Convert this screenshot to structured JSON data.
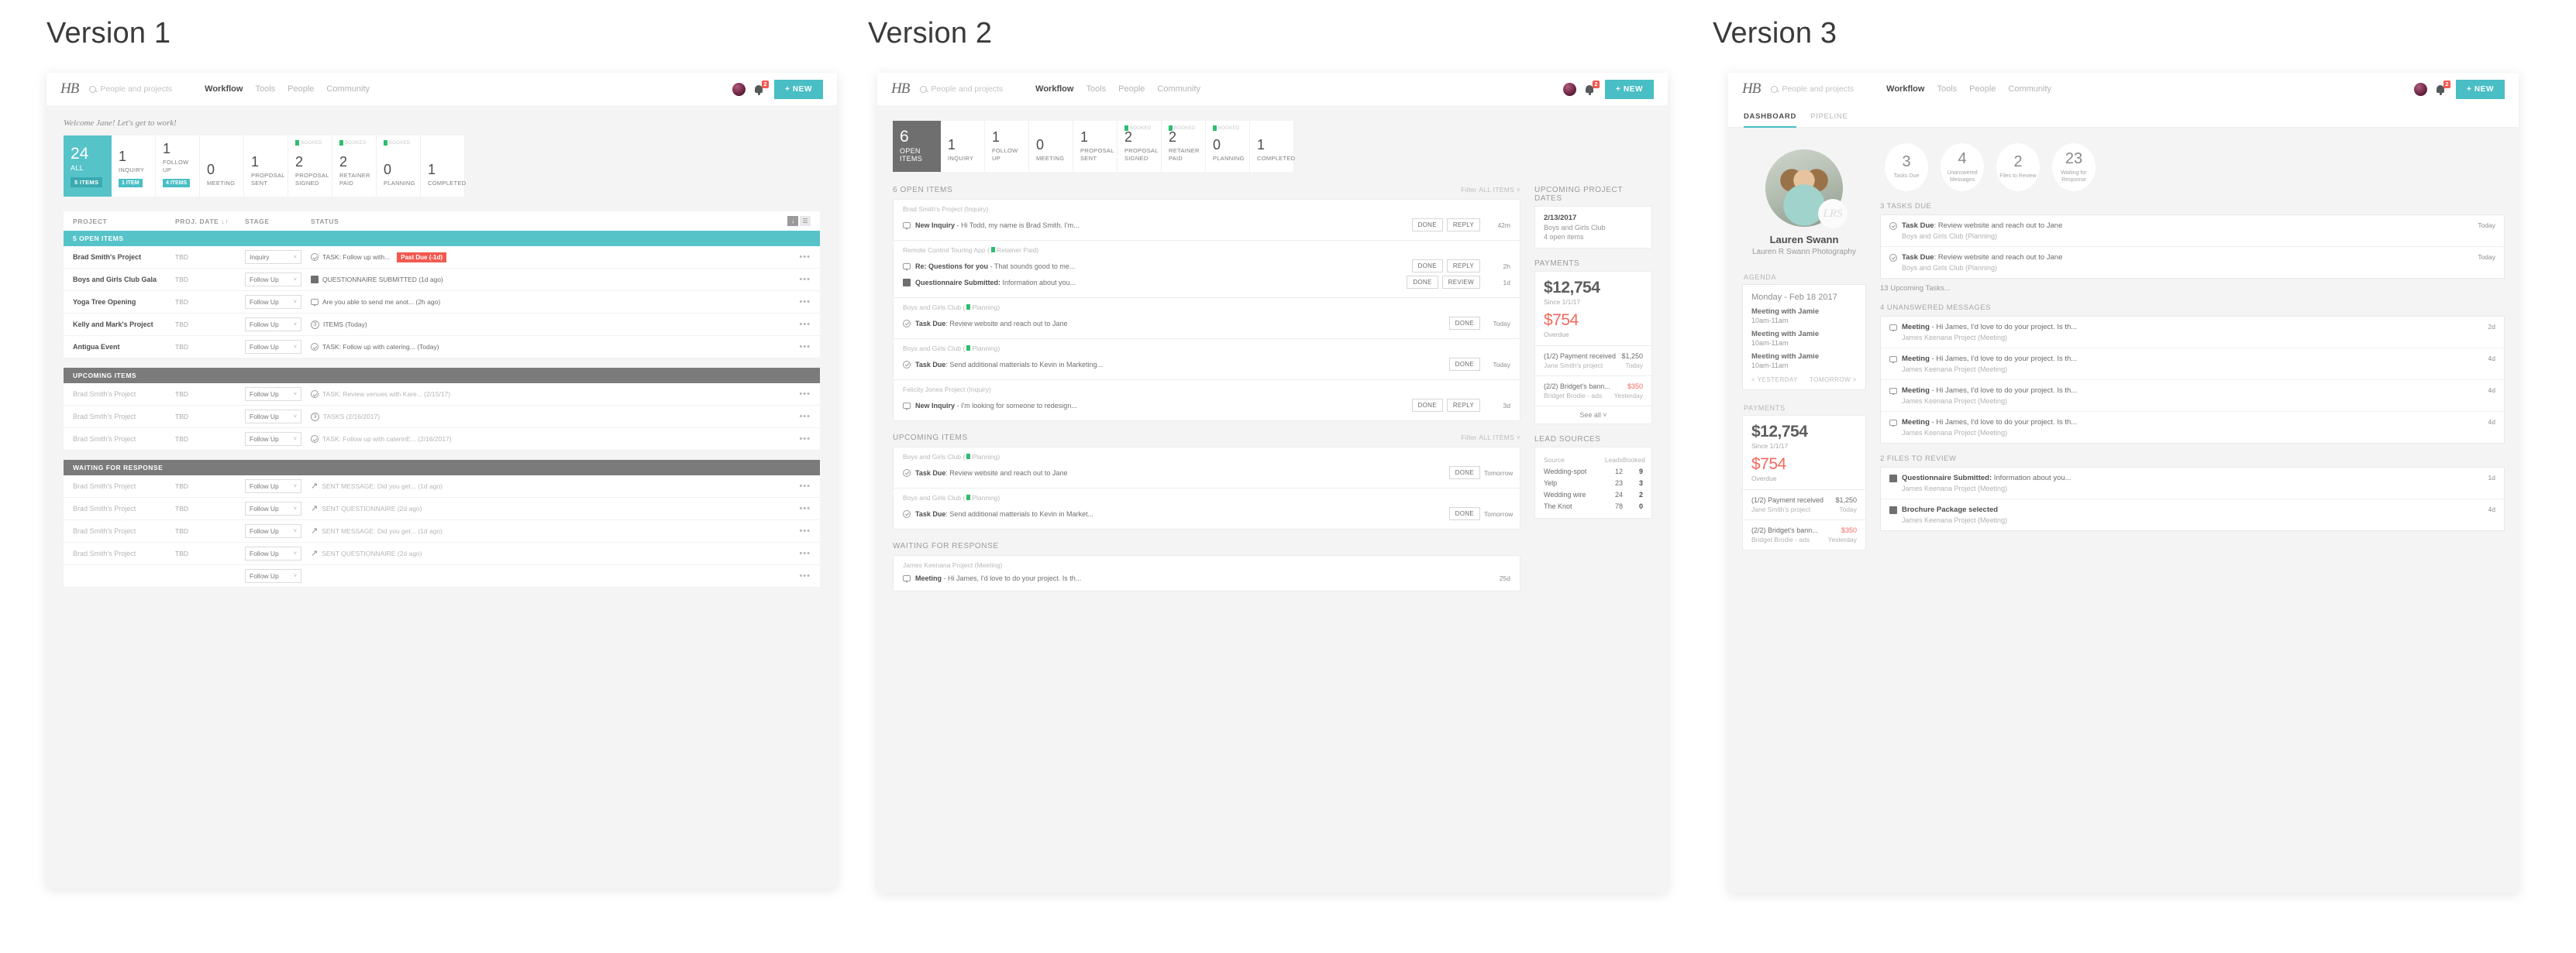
{
  "panels": [
    {
      "title": "Version 1"
    },
    {
      "title": "Version 2"
    },
    {
      "title": "Version 3"
    }
  ],
  "nav": {
    "logo": "HB",
    "search_placeholder": "People and projects",
    "links": [
      "Workflow",
      "Tools",
      "People",
      "Community"
    ],
    "active_link": "Workflow",
    "notification_count": "2",
    "new_button": "+ NEW"
  },
  "v1": {
    "welcome": "Welcome Jane! Let's get to work!",
    "pipeline": {
      "all": {
        "count": "24",
        "label": "ALL",
        "chip": "5 ITEMS"
      },
      "stages": [
        {
          "count": "1",
          "label": "INQUIRY",
          "chip": "1 ITEM",
          "booked": ""
        },
        {
          "count": "1",
          "label": "FOLLOW UP",
          "chip": "4 ITEMS",
          "booked": ""
        },
        {
          "count": "0",
          "label": "MEETING",
          "chip": "",
          "booked": ""
        },
        {
          "count": "1",
          "label": "PROPOSAL SENT",
          "chip": "",
          "booked": ""
        },
        {
          "count": "2",
          "label": "PROPOSAL SIGNED",
          "chip": "",
          "booked": "BOOKED"
        },
        {
          "count": "2",
          "label": "RETAINER PAID",
          "chip": "",
          "booked": "BOOKED"
        },
        {
          "count": "0",
          "label": "PLANNING",
          "chip": "",
          "booked": "BOOKED"
        },
        {
          "count": "1",
          "label": "COMPLETED",
          "chip": "",
          "booked": ""
        }
      ]
    },
    "table": {
      "columns": {
        "project": "PROJECT",
        "date": "PROJ. DATE",
        "sort": "↓↑",
        "stage": "STAGE",
        "status": "STATUS"
      },
      "tools": {
        "download": "download-icon",
        "list": "list-icon"
      },
      "groups": [
        {
          "label": "5 OPEN ITEMS",
          "color": "teal",
          "muted": false,
          "rows": [
            {
              "project": "Brad Smith's Project",
              "date": "TBD",
              "stage": "Inquiry",
              "icon": "check",
              "status": "TASK: Follow up with...",
              "badge": "Past Due (-1d)"
            },
            {
              "project": "Boys and Girls Club Gala",
              "date": "TBD",
              "stage": "Follow Up",
              "icon": "form",
              "status": "QUESTIONNAIRE SUBMITTED (1d ago)",
              "badge": ""
            },
            {
              "project": "Yoga Tree Opening",
              "date": "TBD",
              "stage": "Follow Up",
              "icon": "bubble",
              "status": "Are you able to send me anot... (2h ago)",
              "badge": ""
            },
            {
              "project": "Kelly and Mark's Project",
              "date": "TBD",
              "stage": "Follow Up",
              "icon": "num3",
              "status": "ITEMS (Today)",
              "badge": ""
            },
            {
              "project": "Antigua Event",
              "date": "TBD",
              "stage": "Follow Up",
              "icon": "check",
              "status": "TASK: Follow up with catering... (Today)",
              "badge": ""
            }
          ]
        },
        {
          "label": "UPCOMING ITEMS",
          "color": "gray",
          "muted": true,
          "rows": [
            {
              "project": "Brad Smith's Project",
              "date": "TBD",
              "stage": "Follow Up",
              "icon": "check",
              "status": "TASK: Review venues with Kare... (2/15/17)",
              "badge": ""
            },
            {
              "project": "Brad Smith's Project",
              "date": "TBD",
              "stage": "Follow Up",
              "icon": "num3",
              "status": "TASKS (2/16/2017)",
              "badge": ""
            },
            {
              "project": "Brad Smith's Project",
              "date": "TBD",
              "stage": "Follow Up",
              "icon": "check",
              "status": "TASK: Follow up with caterinE... (2/16/2017)",
              "badge": ""
            }
          ]
        },
        {
          "label": "WAITING FOR RESPONSE",
          "color": "gray",
          "muted": true,
          "rows": [
            {
              "project": "Brad Smith's Project",
              "date": "TBD",
              "stage": "Follow Up",
              "icon": "arrow",
              "status": "SENT MESSAGE: Did you get... (1d ago)",
              "badge": ""
            },
            {
              "project": "Brad Smith's Project",
              "date": "TBD",
              "stage": "Follow Up",
              "icon": "arrow",
              "status": "SENT QUESTIONNAIRE (2d ago)",
              "badge": ""
            },
            {
              "project": "Brad Smith's Project",
              "date": "TBD",
              "stage": "Follow Up",
              "icon": "arrow",
              "status": "SENT MESSAGE: Did you get... (1d ago)",
              "badge": ""
            },
            {
              "project": "Brad Smith's Project",
              "date": "TBD",
              "stage": "Follow Up",
              "icon": "arrow",
              "status": "SENT QUESTIONNAIRE (2d ago)",
              "badge": ""
            },
            {
              "project": "",
              "date": "",
              "stage": "Follow Up",
              "icon": "",
              "status": "",
              "badge": ""
            }
          ]
        }
      ]
    }
  },
  "v2": {
    "pipeline": {
      "all": {
        "count": "6",
        "label": "OPEN ITEMS"
      },
      "stages": [
        {
          "count": "1",
          "label": "INQUIRY",
          "booked": ""
        },
        {
          "count": "1",
          "label": "FOLLOW UP",
          "booked": ""
        },
        {
          "count": "0",
          "label": "MEETING",
          "booked": ""
        },
        {
          "count": "1",
          "label": "PROPOSAL SENT",
          "booked": ""
        },
        {
          "count": "2",
          "label": "PROPOSAL SIGNED",
          "booked": "BOOKED"
        },
        {
          "count": "2",
          "label": "RETAINER PAID",
          "booked": "BOOKED"
        },
        {
          "count": "0",
          "label": "PLANNING",
          "booked": "BOOKED"
        },
        {
          "count": "1",
          "label": "COMPLETED",
          "booked": ""
        }
      ]
    },
    "open_items": {
      "title": "6 OPEN ITEMS",
      "filter": "Filter  ALL ITEMS",
      "groups": [
        {
          "label": "Brad Smith's Project (Inquiry)",
          "flag": false,
          "items": [
            {
              "icon": "bubble",
              "bold": "New Inquiry",
              "rest": " - Hi Todd, my name is Brad Smith. I'm...",
              "buttons": [
                "DONE",
                "REPLY"
              ],
              "time": "42m"
            }
          ]
        },
        {
          "label": "Remote Control Touring App (",
          "flag": true,
          "label_tail": "Retainer Paid)",
          "items": [
            {
              "icon": "bubble",
              "bold": "Re: Questions for you",
              "rest": " - That sounds good to me...",
              "buttons": [
                "DONE",
                "REPLY"
              ],
              "time": "2h"
            },
            {
              "icon": "form",
              "bold": "Questionnaire Submitted:",
              "rest": " Information about you...",
              "buttons": [
                "DONE",
                "REVIEW"
              ],
              "time": "1d"
            }
          ]
        },
        {
          "label": "Boys and Girls Club (",
          "flag": true,
          "label_tail": "Planning)",
          "items": [
            {
              "icon": "check",
              "bold": "Task Due",
              "rest": ": Review website and reach out to Jane",
              "buttons": [
                "DONE"
              ],
              "time": "Today"
            }
          ]
        },
        {
          "label": "Boys and Girls Club (",
          "flag": true,
          "label_tail": "Planning)",
          "items": [
            {
              "icon": "check",
              "bold": "Task Due",
              "rest": ": Send additional matterials to Kevin in Marketing...",
              "buttons": [
                "DONE"
              ],
              "time": "Today"
            }
          ]
        },
        {
          "label": "Felicity Jones Project (Inquiry)",
          "flag": false,
          "items": [
            {
              "icon": "bubble",
              "bold": "New Inquiry",
              "rest": " - I'm looking for someone to redesign...",
              "buttons": [
                "DONE",
                "REPLY"
              ],
              "time": "3d"
            }
          ]
        }
      ]
    },
    "upcoming_items": {
      "title": "UPCOMING ITEMS",
      "filter": "Filter  ALL ITEMS",
      "groups": [
        {
          "label": "Boys and Girls Club (",
          "flag": true,
          "label_tail": "Planning)",
          "items": [
            {
              "icon": "check",
              "bold": "Task Due",
              "rest": ": Review website and reach out to Jane",
              "buttons": [
                "DONE"
              ],
              "time": "Tomorrow"
            }
          ]
        },
        {
          "label": "Boys and Girls Club (",
          "flag": true,
          "label_tail": "Planning)",
          "items": [
            {
              "icon": "check",
              "bold": "Task Due",
              "rest": ": Send additional matterials to Kevin in Market...",
              "buttons": [
                "DONE"
              ],
              "time": "Tomorrow"
            }
          ]
        }
      ]
    },
    "waiting": {
      "title": "WAITING FOR RESPONSE",
      "groups": [
        {
          "label": "James Keenana Project (Meeting)",
          "flag": false,
          "items": [
            {
              "icon": "bubble",
              "bold": "Meeting",
              "rest": " - Hi James, I'd love to do your project. Is th...",
              "buttons": [],
              "time": "25d"
            }
          ]
        }
      ]
    },
    "upcoming_dates": {
      "title": "UPCOMING PROJECT DATES",
      "date": "2/13/2017",
      "project": "Boys and Girls Club",
      "items": "4 open items"
    },
    "payments": {
      "title": "PAYMENTS",
      "total": "$12,754",
      "total_sub": "Since 1/1/17",
      "overdue": "$754",
      "overdue_sub": "Overdue",
      "rows": [
        {
          "l1": "(1/2) Payment received",
          "l2": "Jane Smith's project",
          "r1": "$1,250",
          "r2": "Today",
          "red": false
        },
        {
          "l1": "(2/2) Bridget's bann...",
          "l2": "Bridget Brodie - ads",
          "r1": "$350",
          "r2": "Yesterday",
          "red": true
        }
      ],
      "see_all": "See all"
    },
    "lead_sources": {
      "title": "LEAD SOURCES",
      "columns": [
        "Source",
        "Leads",
        "Booked"
      ],
      "rows": [
        {
          "source": "Wedding-spot",
          "leads": "12",
          "booked": "9"
        },
        {
          "source": "Yelp",
          "leads": "23",
          "booked": "3"
        },
        {
          "source": "Wedding wire",
          "leads": "24",
          "booked": "2"
        },
        {
          "source": "The Knot",
          "leads": "78",
          "booked": "0"
        }
      ]
    }
  },
  "v3": {
    "tabs": [
      "DASHBOARD",
      "PIPELINE"
    ],
    "active_tab": "DASHBOARD",
    "profile": {
      "name": "Lauren Swann",
      "business": "Lauren R Swann Photography",
      "signature": "LRS"
    },
    "agenda": {
      "title": "AGENDA",
      "date": "Monday - Feb 18 2017",
      "items": [
        {
          "title": "Meeting with Jamie",
          "time": "10am-11am"
        },
        {
          "title": "Meeting with Jamie",
          "time": "10am-11am"
        },
        {
          "title": "Meeting with Jamie",
          "time": "10am-11am"
        }
      ],
      "prev": "< YESTERDAY",
      "next": "TOMORROW >"
    },
    "payments": {
      "title": "PAYMENTS",
      "total": "$12,754",
      "total_sub": "Since 1/1/17",
      "overdue": "$754",
      "overdue_sub": "Overdue",
      "rows": [
        {
          "l1": "(1/2) Payment received",
          "l2": "Jane Smith's project",
          "r1": "$1,250",
          "r2": "Today",
          "red": false
        },
        {
          "l1": "(2/2) Bridget's bann...",
          "l2": "Bridget Brodie - ads",
          "r1": "$350",
          "r2": "Yesterday",
          "red": true
        }
      ]
    },
    "metrics": [
      {
        "value": "3",
        "label": "Tasks Due"
      },
      {
        "value": "4",
        "label": "Unanswered Messages"
      },
      {
        "value": "2",
        "label": "Files to Review"
      },
      {
        "value": "23",
        "label": "Waiting for Response"
      }
    ],
    "tasks": {
      "title": "3 TASKS DUE",
      "more": "13 Upcoming Tasks...",
      "rows": [
        {
          "icon": "check",
          "bold": "Task Due",
          "rest": ": Review website and reach out to Jane",
          "sub": "Boys and Girls Club (Planning)",
          "time": "Today"
        },
        {
          "icon": "check",
          "bold": "Task Due",
          "rest": ": Review website and reach out to Jane",
          "sub": "Boys and Girls Club (Planning)",
          "time": "Today"
        }
      ]
    },
    "messages": {
      "title": "4 UNANSWERED MESSAGES",
      "rows": [
        {
          "icon": "bubble",
          "bold": "Meeting",
          "rest": " - Hi James, I'd love to do your project. Is th...",
          "sub": "James Keenana Project (Meeting)",
          "time": "2d"
        },
        {
          "icon": "bubble",
          "bold": "Meeting",
          "rest": " - Hi James, I'd love to do your project. Is th...",
          "sub": "James Keenana Project (Meeting)",
          "time": "4d"
        },
        {
          "icon": "bubble",
          "bold": "Meeting",
          "rest": " - Hi James, I'd love to do your project. Is th...",
          "sub": "James Keenana Project (Meeting)",
          "time": "4d"
        },
        {
          "icon": "bubble",
          "bold": "Meeting",
          "rest": " - Hi James, I'd love to do your project. Is th...",
          "sub": "James Keenana Project (Meeting)",
          "time": "4d"
        }
      ]
    },
    "files": {
      "title": "2 FILES TO REVIEW",
      "rows": [
        {
          "icon": "form",
          "bold": "Questionnaire Submitted:",
          "rest": " Information about you...",
          "sub": "James Keenana Project (Meeting)",
          "time": "1d"
        },
        {
          "icon": "doc",
          "bold": "Brochure Package selected",
          "rest": "",
          "sub": "James Keenana Project (Meeting)",
          "time": "4d"
        }
      ]
    }
  },
  "colors": {
    "teal": "#49bec5",
    "red": "#f2584f",
    "green": "#2fbd6f",
    "gray": "#7b7b7b"
  }
}
